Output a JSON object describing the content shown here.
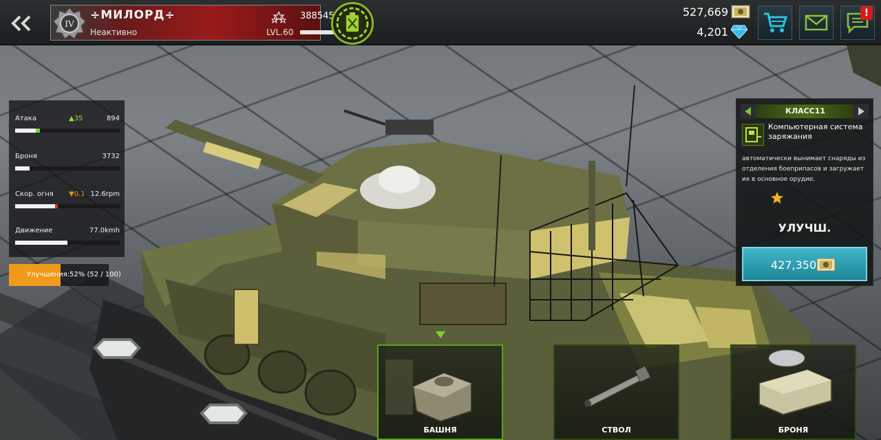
{
  "header": {
    "player_name": "÷МИЛОРД÷",
    "status": "Неактивно",
    "rank_badge": "IV",
    "level": "LVL.60",
    "power": "388545",
    "power_arrow": "🠕",
    "currency_coins": "527,669",
    "currency_gems": "4,201",
    "alert": "!"
  },
  "icons": {
    "back": "double-chevron-left-icon",
    "fuel": "jerrycan-icon",
    "cart": "cart-icon",
    "mail": "mail-icon",
    "chat": "chat-icon",
    "coin": "gold-bar-icon",
    "gem": "diamond-icon"
  },
  "stats": [
    {
      "label": "Атака",
      "delta": "▲35",
      "delta_color": "#8ed63a",
      "value": "894",
      "fill": 0.2,
      "ext": 0.04,
      "ext_color": "#7bd23a"
    },
    {
      "label": "Броня",
      "delta": "",
      "delta_color": "#ffffff",
      "value": "3732",
      "fill": 0.14,
      "ext": 0,
      "ext_color": "#ffffff"
    },
    {
      "label": "Скор. огня",
      "delta": "▼0.1",
      "delta_color": "#f08a1b",
      "value": "12.6rpm",
      "fill": 0.38,
      "ext": 0.03,
      "ext_color": "#e0321e"
    },
    {
      "label": "Движение",
      "delta": "",
      "delta_color": "#ffffff",
      "value": "77.0kmh",
      "fill": 0.5,
      "ext": 0,
      "ext_color": "#ffffff"
    }
  ],
  "upgrades": {
    "text": "Улучшения:52%  (52 / 100)",
    "progress": 0.52
  },
  "module": {
    "class_label": "КЛАСС11",
    "title": "Компьютерная система заряжания",
    "description": "автоматически вынимает снаряды из отделения боеприпасов и загружает их в основное орудие.",
    "stars": 1,
    "upgrade_label": "УЛУЧШ.",
    "price": "427,350"
  },
  "parts": [
    {
      "label": "БАШНЯ",
      "active": true
    },
    {
      "label": "СТВОЛ",
      "active": false
    },
    {
      "label": "БРОНЯ",
      "active": false
    }
  ],
  "colors": {
    "accent_green": "#8ab628",
    "buy_button": "#2aa0b2",
    "progress_orange": "#f09a1b"
  }
}
